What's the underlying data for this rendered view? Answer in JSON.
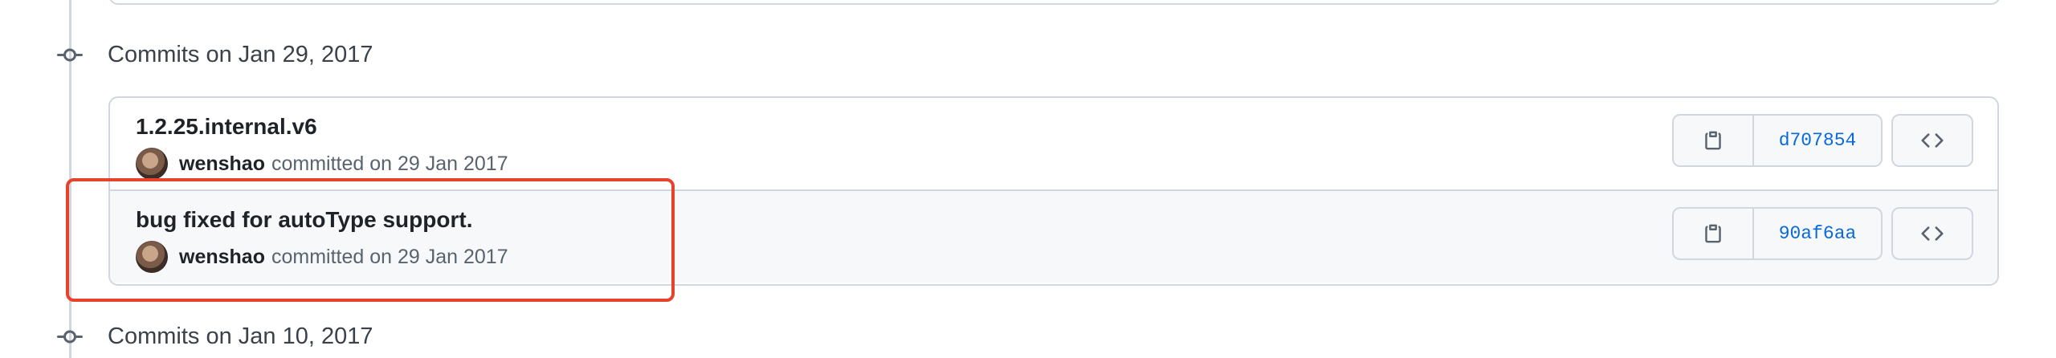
{
  "groups": [
    {
      "title": "Commits on Jan 29, 2017",
      "commits": [
        {
          "title": "1.2.25.internal.v6",
          "author": "wenshao",
          "committed": "committed on 29 Jan 2017",
          "sha": "d707854"
        },
        {
          "title": "bug fixed for autoType support.",
          "author": "wenshao",
          "committed": "committed on 29 Jan 2017",
          "sha": "90af6aa"
        }
      ]
    },
    {
      "title": "Commits on Jan 10, 2017"
    }
  ],
  "icons": {
    "commit_node": "git-commit-icon",
    "copy": "copy-icon",
    "browse": "code-icon"
  },
  "colors": {
    "highlight": "#e8412c",
    "sha_link": "#0969da",
    "border": "#d0d7de"
  }
}
